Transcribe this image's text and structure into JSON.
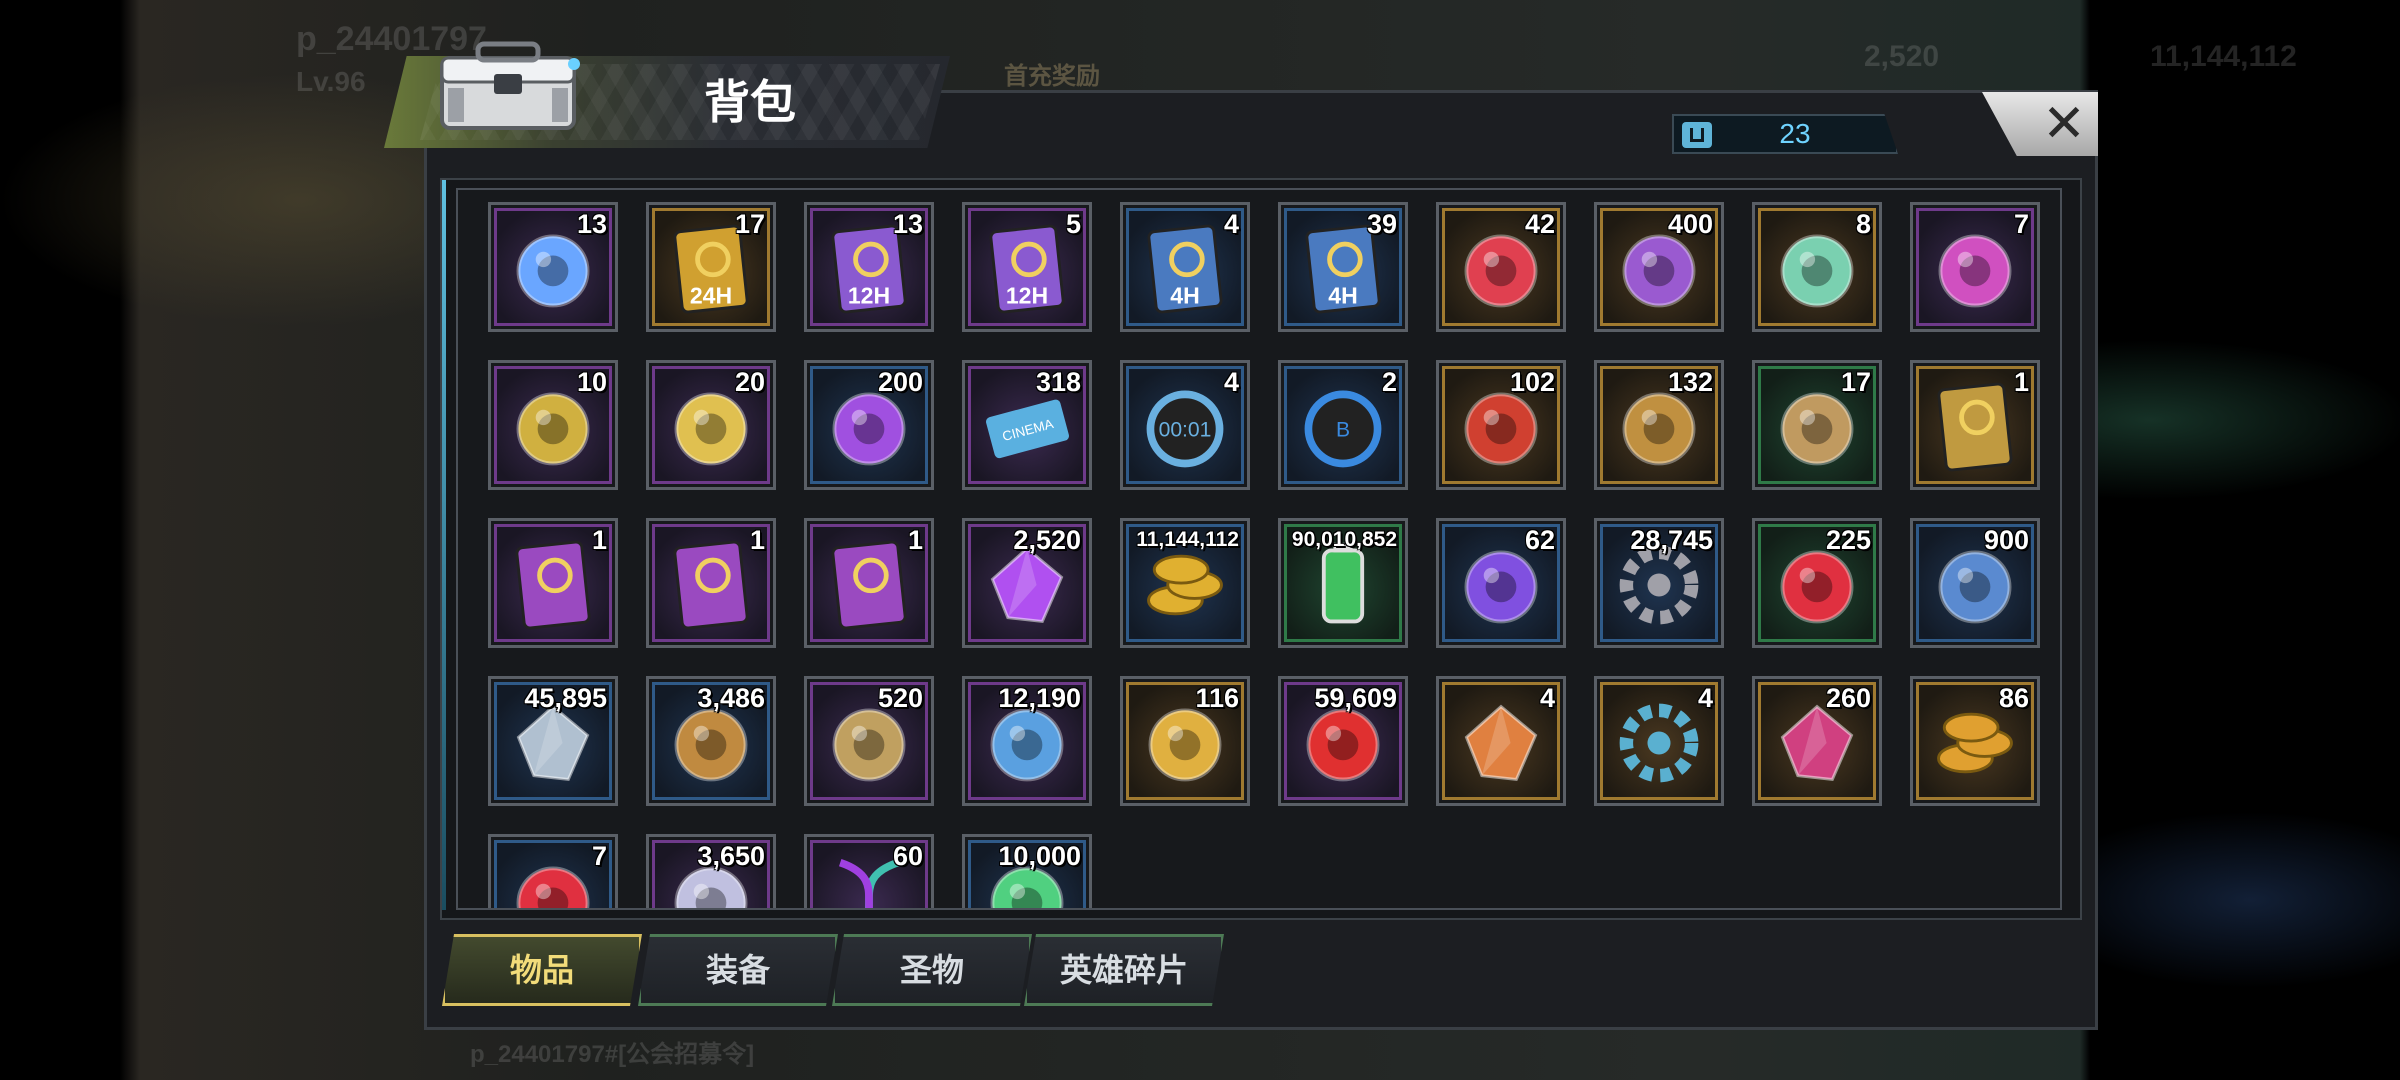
{
  "background": {
    "player_name": "p_24401797",
    "player_level": "Lv.96",
    "currency_1": "2,520",
    "currency_2": "11,144,112",
    "event_label": "首充奖励",
    "chat_text": "p_24401797#[公会招募令]"
  },
  "header": {
    "title": "背包",
    "capacity": "23"
  },
  "close_label": "✕",
  "items": [
    {
      "name": "hover-device",
      "qty": "13",
      "rarity": "purple",
      "color": "#6aa6ff",
      "icon": "device-icon"
    },
    {
      "name": "speedup-24h",
      "qty": "17",
      "rarity": "gold",
      "color": "#d0a030",
      "icon": "card-24h-icon",
      "text": "24H"
    },
    {
      "name": "speedup-12h-a",
      "qty": "13",
      "rarity": "purple",
      "color": "#8a5ad0",
      "icon": "card-12h-icon",
      "text": "12H"
    },
    {
      "name": "speedup-12h-b",
      "qty": "5",
      "rarity": "purple",
      "color": "#8a5ad0",
      "icon": "card-12h-icon",
      "text": "12H"
    },
    {
      "name": "speedup-4h-a",
      "qty": "4",
      "rarity": "blue",
      "color": "#4a7ac0",
      "icon": "card-4h-icon",
      "text": "4H"
    },
    {
      "name": "speedup-4h-b",
      "qty": "39",
      "rarity": "blue",
      "color": "#4a7ac0",
      "icon": "card-4h-icon",
      "text": "4H"
    },
    {
      "name": "red-capsule",
      "qty": "42",
      "rarity": "gold",
      "color": "#e04050",
      "icon": "capsule-icon"
    },
    {
      "name": "demon-mask",
      "qty": "400",
      "rarity": "gold",
      "color": "#9a5ad0",
      "icon": "mask-icon"
    },
    {
      "name": "jade-outfit",
      "qty": "8",
      "rarity": "gold",
      "color": "#7ad0b0",
      "icon": "outfit-icon"
    },
    {
      "name": "film-reel",
      "qty": "7",
      "rarity": "purple",
      "color": "#d050c0",
      "icon": "film-reel-icon"
    },
    {
      "name": "spade-chip",
      "qty": "10",
      "rarity": "purple",
      "color": "#d0b040",
      "icon": "chip-icon"
    },
    {
      "name": "police-badge",
      "qty": "20",
      "rarity": "purple",
      "color": "#e0c050",
      "icon": "badge-icon"
    },
    {
      "name": "violet-emblem",
      "qty": "200",
      "rarity": "blue",
      "color": "#a050e0",
      "icon": "emblem-icon"
    },
    {
      "name": "cinema-ticket",
      "qty": "318",
      "rarity": "purple",
      "color": "#5ab0e0",
      "icon": "ticket-icon",
      "text": "CINEMA"
    },
    {
      "name": "timer-device",
      "qty": "4",
      "rarity": "blue",
      "color": "#6ab0e0",
      "icon": "timer-icon",
      "text": "00:01"
    },
    {
      "name": "bottle-cap",
      "qty": "2",
      "rarity": "blue",
      "color": "#3a8ae0",
      "icon": "bottle-cap-icon",
      "text": "B"
    },
    {
      "name": "poker-chip",
      "qty": "102",
      "rarity": "gold",
      "color": "#d04030",
      "icon": "poker-chip-icon"
    },
    {
      "name": "bullet",
      "qty": "132",
      "rarity": "gold",
      "color": "#c09040",
      "icon": "bullet-icon"
    },
    {
      "name": "sandals",
      "qty": "17",
      "rarity": "green",
      "color": "#c09a60",
      "icon": "sandal-icon"
    },
    {
      "name": "gold-blueprint",
      "qty": "1",
      "rarity": "gold",
      "color": "#c09a40",
      "icon": "blueprint-icon"
    },
    {
      "name": "hat-blueprint",
      "qty": "1",
      "rarity": "purple",
      "color": "#9a4ac0",
      "icon": "hat-blueprint-icon"
    },
    {
      "name": "boots-blueprint",
      "qty": "1",
      "rarity": "purple",
      "color": "#9a4ac0",
      "icon": "boots-blueprint-icon"
    },
    {
      "name": "gun-blueprint",
      "qty": "1",
      "rarity": "purple",
      "color": "#9a4ac0",
      "icon": "gun-blueprint-icon"
    },
    {
      "name": "diamonds",
      "qty": "2,520",
      "rarity": "purple",
      "color": "#b050f0",
      "icon": "diamond-icon"
    },
    {
      "name": "gold-coins",
      "qty": "11,144,112",
      "rarity": "blue",
      "color": "#e0b030",
      "icon": "coin-stack-icon",
      "small": true
    },
    {
      "name": "green-battery",
      "qty": "90,010,852",
      "rarity": "green",
      "color": "#40c060",
      "icon": "battery-icon",
      "small": true
    },
    {
      "name": "purple-core",
      "qty": "62",
      "rarity": "blue",
      "color": "#8050e0",
      "icon": "core-icon"
    },
    {
      "name": "gear-parts",
      "qty": "28,745",
      "rarity": "blue",
      "color": "#a0a0a8",
      "icon": "gear-icon"
    },
    {
      "name": "red-chip",
      "qty": "225",
      "rarity": "green",
      "color": "#e03040",
      "icon": "red-chip-icon"
    },
    {
      "name": "eye-tag",
      "qty": "900",
      "rarity": "blue",
      "color": "#5a8ad0",
      "icon": "eye-icon"
    },
    {
      "name": "silver-shard",
      "qty": "45,895",
      "rarity": "blue",
      "color": "#b0c0d0",
      "icon": "shard-icon"
    },
    {
      "name": "fist-medal",
      "qty": "3,486",
      "rarity": "blue",
      "color": "#c08a40",
      "icon": "fist-icon"
    },
    {
      "name": "puzzle-piece",
      "qty": "520",
      "rarity": "purple",
      "color": "#c0a060",
      "icon": "puzzle-icon"
    },
    {
      "name": "blue-medal",
      "qty": "12,190",
      "rarity": "purple",
      "color": "#5aa0e0",
      "icon": "medal-icon"
    },
    {
      "name": "gold-medal",
      "qty": "116",
      "rarity": "gold",
      "color": "#e0b040",
      "icon": "medal-gold-icon"
    },
    {
      "name": "red-cube",
      "qty": "59,609",
      "rarity": "purple",
      "color": "#e03030",
      "icon": "cube-icon"
    },
    {
      "name": "orange-shard",
      "qty": "4",
      "rarity": "gold",
      "color": "#e08040",
      "icon": "orange-shard-icon"
    },
    {
      "name": "fan-blade",
      "qty": "4",
      "rarity": "gold",
      "color": "#5ab0d0",
      "icon": "fan-icon"
    },
    {
      "name": "ruby-crystal",
      "qty": "260",
      "rarity": "gold",
      "color": "#d04080",
      "icon": "crystal-icon"
    },
    {
      "name": "bronze-coins",
      "qty": "86",
      "rarity": "gold",
      "color": "#e0a030",
      "icon": "bronze-coin-icon"
    },
    {
      "name": "red-target",
      "qty": "7",
      "rarity": "blue",
      "color": "#e03040",
      "icon": "target-icon"
    },
    {
      "name": "silver-orb",
      "qty": "3,650",
      "rarity": "purple",
      "color": "#c0c0e0",
      "icon": "orb-icon"
    },
    {
      "name": "dna-helix",
      "qty": "60",
      "rarity": "purple",
      "color": "#40c0b0",
      "icon": "dna-icon"
    },
    {
      "name": "green-sphere",
      "qty": "10,000",
      "rarity": "blue",
      "color": "#50d080",
      "icon": "sphere-icon"
    }
  ],
  "tabs": [
    {
      "label": "物品",
      "active": true
    },
    {
      "label": "装备",
      "active": false
    },
    {
      "label": "圣物",
      "active": false
    },
    {
      "label": "英雄碎片",
      "active": false
    }
  ]
}
